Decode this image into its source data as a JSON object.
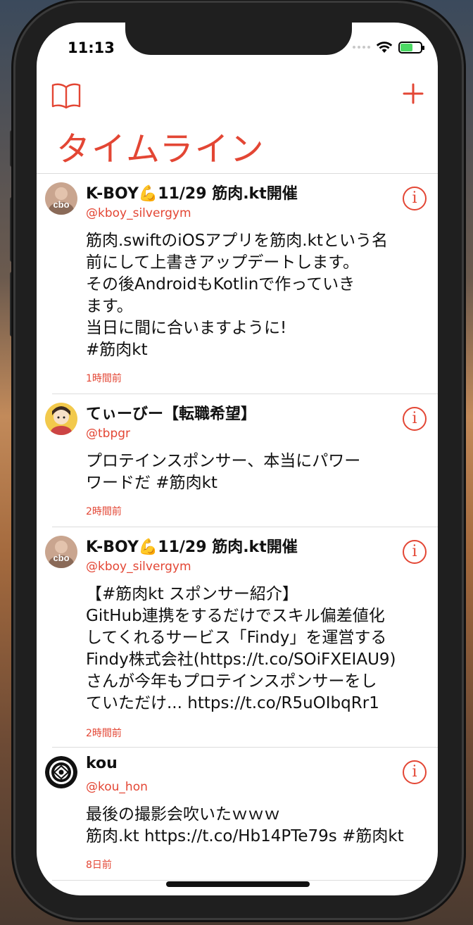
{
  "status_bar": {
    "time": "11:13"
  },
  "nav": {
    "title": "タイムライン"
  },
  "tweets": [
    {
      "name": "K-BOY💪11/29 筋肉.kt開催",
      "handle": "@kboy_silvergym",
      "body": "筋肉.swiftのiOSアプリを筋肉.ktという名\n前にして上書きアップデートします。\nその後AndroidもKotlinで作っていき\nます。\n当日に間に合いますように!\n #筋肉kt",
      "time": "1時間前",
      "avatar_text": "cbo"
    },
    {
      "name": "てぃーびー【転職希望】",
      "handle": "@tbpgr",
      "body": "プロテインスポンサー、本当にパワー\nワードだ #筋肉kt",
      "time": "2時間前",
      "avatar_text": ""
    },
    {
      "name": "K-BOY💪11/29 筋肉.kt開催",
      "handle": "@kboy_silvergym",
      "body": "【#筋肉kt スポンサー紹介】\nGitHub連携をするだけでスキル偏差値化\nしてくれるサービス「Findy」を運営する\nFindy株式会社(https://t.co/SOiFXEIAU9)\nさんが今年もプロテインスポンサーをし\nていただけ... https://t.co/R5uOIbqRr1",
      "time": "2時間前",
      "avatar_text": "cbo"
    },
    {
      "name": "kou",
      "handle": "@kou_hon",
      "body": "最後の撮影会吹いたｗｗｗ\n筋肉.kt https://t.co/Hb14PTe79s #筋肉kt",
      "time": "8日前",
      "avatar_text": ""
    }
  ],
  "colors": {
    "accent": "#e34634",
    "text": "#111111",
    "separator": "#dcdcdc",
    "battery": "#4cd964"
  }
}
